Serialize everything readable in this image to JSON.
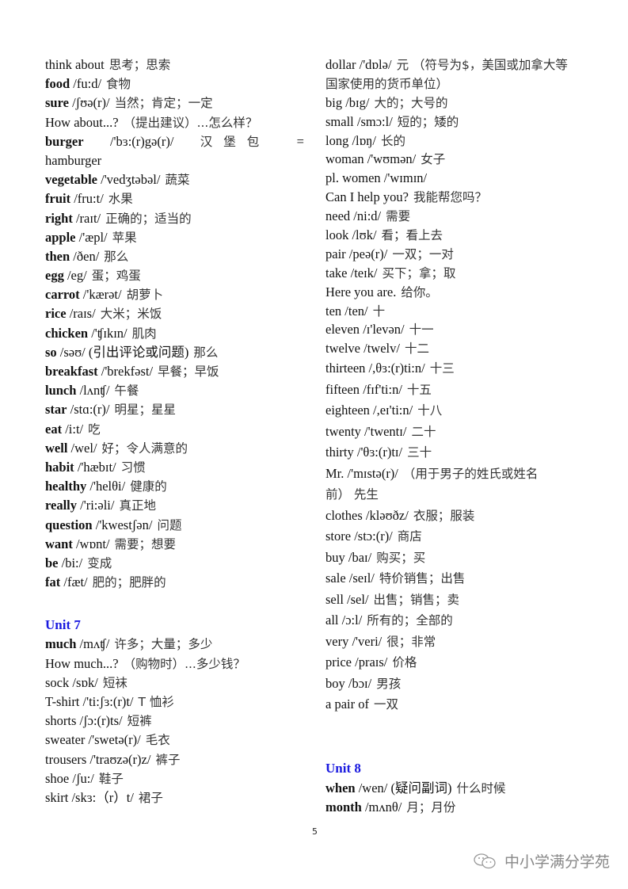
{
  "left_column": [
    {
      "word": "think about",
      "bold": false,
      "phon": "",
      "cn": "思考；思索"
    },
    {
      "word": "food",
      "bold": true,
      "phon": "/fu:d/",
      "cn": "食物"
    },
    {
      "word": "sure",
      "bold": true,
      "phon": "/ʃʊə(r)/",
      "cn": "当然；肯定；一定"
    },
    {
      "word": "How about...?",
      "bold": false,
      "phon": "",
      "cn": "（提出建议）...怎么样？"
    },
    {
      "word": "burger",
      "bold": true,
      "phon": "/'bɜ:(r)gə(r)/",
      "cn": "汉堡包",
      "tail": "=",
      "wrap": "hamburger"
    },
    {
      "word": "vegetable",
      "bold": true,
      "phon": "/'vedʒtəbəl/",
      "cn": "蔬菜"
    },
    {
      "word": "fruit",
      "bold": true,
      "phon": "/fru:t/",
      "cn": "水果"
    },
    {
      "word": "right",
      "bold": true,
      "phon": "/raɪt/",
      "cn": "正确的；适当的"
    },
    {
      "word": "apple",
      "bold": true,
      "phon": "/'æpl/",
      "cn": "苹果"
    },
    {
      "word": "then",
      "bold": true,
      "phon": "/ðen/",
      "cn": "那么"
    },
    {
      "word": "egg",
      "bold": true,
      "phon": "/eg/",
      "cn": "蛋；鸡蛋"
    },
    {
      "word": "carrot",
      "bold": true,
      "phon": "/'kærət/",
      "cn": "胡萝卜"
    },
    {
      "word": "rice",
      "bold": true,
      "phon": "/raɪs/",
      "cn": "大米；米饭"
    },
    {
      "word": "chicken",
      "bold": true,
      "phon": "/'ʧɪkɪn/",
      "cn": "肌肉"
    },
    {
      "word": "so",
      "bold": true,
      "phon": "/səʊ/ (引出评论或问题)",
      "cn": "那么"
    },
    {
      "word": "breakfast",
      "bold": true,
      "phon": "/'brekfəst/",
      "cn": "早餐；早饭"
    },
    {
      "word": "lunch",
      "bold": true,
      "phon": "/lʌnʧ/",
      "cn": "午餐"
    },
    {
      "word": "star",
      "bold": true,
      "phon": "/stɑ:(r)/",
      "cn": "明星；星星"
    },
    {
      "word": "eat",
      "bold": true,
      "phon": "/i:t/",
      "cn": "吃"
    },
    {
      "word": "well",
      "bold": true,
      "phon": "/wel/",
      "cn": "好；令人满意的"
    },
    {
      "word": "habit",
      "bold": true,
      "phon": "/'hæbɪt/",
      "cn": "习惯"
    },
    {
      "word": "healthy",
      "bold": true,
      "phon": "/'helθi/",
      "cn": "健康的"
    },
    {
      "word": "really",
      "bold": true,
      "phon": "/'ri:əli/",
      "cn": "真正地"
    },
    {
      "word": "question",
      "bold": true,
      "phon": "/'kwestʃən/",
      "cn": "问题"
    },
    {
      "word": "want",
      "bold": true,
      "phon": "/wɒnt/",
      "cn": "需要；想要"
    },
    {
      "word": "be",
      "bold": true,
      "phon": "/bi:/",
      "cn": "变成"
    },
    {
      "word": "fat",
      "bold": true,
      "phon": "/fæt/",
      "cn": "肥的；肥胖的"
    }
  ],
  "unit7": {
    "heading": "Unit 7",
    "items": [
      {
        "word": "much",
        "bold": true,
        "phon": "/mʌʧ/",
        "cn": "许多；大量；多少"
      },
      {
        "word": "How much...?",
        "bold": false,
        "phon": "",
        "cn": "（购物时）...多少钱？"
      },
      {
        "word": "sock",
        "bold": false,
        "phon": "/sɒk/",
        "cn": "短袜"
      },
      {
        "word": "T-shirt",
        "bold": false,
        "phon": "/'ti:ʃɜ:(r)t/",
        "cn": "T 恤衫"
      },
      {
        "word": "shorts",
        "bold": false,
        "phon": "/ʃɔ:(r)ts/",
        "cn": "短裤"
      },
      {
        "word": "sweater",
        "bold": false,
        "phon": "/'swetə(r)/",
        "cn": "毛衣"
      },
      {
        "word": "trousers",
        "bold": false,
        "phon": "/'traʊzə(r)z/",
        "cn": "裤子"
      },
      {
        "word": "shoe",
        "bold": false,
        "phon": "/ʃu:/",
        "cn": "鞋子"
      },
      {
        "word": "skirt",
        "bold": false,
        "phon": "/skɜ:（r）t/",
        "cn": "裙子"
      }
    ]
  },
  "right_column": [
    {
      "word": "dollar",
      "bold": false,
      "phon": "/'dɒlə/",
      "cn": "元 （符号为$，美国或加拿大等",
      "wrap": "国家使用的货币单位）"
    },
    {
      "word": "big",
      "bold": false,
      "phon": "/bɪg/",
      "cn": "大的；大号的"
    },
    {
      "word": "small",
      "bold": false,
      "phon": "/smɔ:l/",
      "cn": "短的；矮的"
    },
    {
      "word": "long",
      "bold": false,
      "phon": "/lɒŋ/",
      "cn": "长的"
    },
    {
      "word": "woman",
      "bold": false,
      "phon": "/'wʊmən/",
      "cn": "女子"
    },
    {
      "word": "pl. women",
      "bold": false,
      "phon": "/'wɪmɪn/",
      "cn": ""
    },
    {
      "word": "Can I help you?",
      "bold": false,
      "phon": "",
      "cn": "我能帮您吗？"
    },
    {
      "word": "need",
      "bold": false,
      "phon": "/ni:d/",
      "cn": "需要"
    },
    {
      "word": "look",
      "bold": false,
      "phon": "/lʊk/",
      "cn": "看；看上去"
    },
    {
      "word": "pair",
      "bold": false,
      "phon": "/peə(r)/",
      "cn": "一双；一对"
    },
    {
      "word": "take",
      "bold": false,
      "phon": "/teɪk/",
      "cn": "买下；拿；取"
    },
    {
      "word": "Here you are.",
      "bold": false,
      "phon": "",
      "cn": "给你。"
    },
    {
      "word": "ten",
      "bold": false,
      "phon": "/ten/",
      "cn": "十"
    },
    {
      "word": "eleven",
      "bold": false,
      "phon": "/ɪ'levən/",
      "cn": "十一"
    },
    {
      "word": "twelve",
      "bold": false,
      "phon": "/twelv/",
      "cn": "十二"
    },
    {
      "word": "thirteen",
      "bold": false,
      "phon": "/,θɜ:(r)ti:n/",
      "cn": "十三"
    },
    {
      "word": "fifteen",
      "bold": false,
      "phon": "/fɪf'ti:n/",
      "cn": "十五"
    },
    {
      "word": "eighteen",
      "bold": false,
      "phon": "/,eɪ'ti:n/",
      "cn": "十八"
    },
    {
      "word": "twenty",
      "bold": false,
      "phon": "/'twentɪ/",
      "cn": "二十"
    },
    {
      "word": "thirty",
      "bold": false,
      "phon": "/'θɜ:(r)tɪ/",
      "cn": "三十"
    },
    {
      "word": "Mr.",
      "bold": false,
      "phon": "/'mɪstə(r)/",
      "cn": "（用于男子的姓氏或姓名",
      "wrap": "前） 先生"
    },
    {
      "word": "clothes",
      "bold": false,
      "phon": "/kləʊðz/",
      "cn": "衣服；服装"
    },
    {
      "word": "store",
      "bold": false,
      "phon": "/stɔ:(r)/",
      "cn": "商店"
    },
    {
      "word": "buy",
      "bold": false,
      "phon": "/baɪ/",
      "cn": "购买；买"
    },
    {
      "word": "sale",
      "bold": false,
      "phon": "/seɪl/",
      "cn": "特价销售；出售"
    },
    {
      "word": "sell",
      "bold": false,
      "phon": "/sel/",
      "cn": "出售；销售；卖"
    },
    {
      "word": "all",
      "bold": false,
      "phon": "/ɔ:l/",
      "cn": "所有的；全部的"
    },
    {
      "word": "very",
      "bold": false,
      "phon": "/'veri/",
      "cn": "很；非常"
    },
    {
      "word": "price",
      "bold": false,
      "phon": "/praɪs/",
      "cn": "价格"
    },
    {
      "word": "boy",
      "bold": false,
      "phon": "/bɔɪ/",
      "cn": "男孩"
    },
    {
      "word": "a pair of",
      "bold": false,
      "phon": "",
      "cn": "一双"
    }
  ],
  "unit8": {
    "heading": "Unit 8",
    "items": [
      {
        "word": "when",
        "bold": true,
        "phon": "/wen/ (疑问副词)",
        "cn": "什么时候"
      },
      {
        "word": "month",
        "bold": true,
        "phon": "/mʌnθ/",
        "cn": "月；月份"
      }
    ]
  },
  "footer": {
    "page_number": "5",
    "watermark": "中小学满分学苑",
    "watermark_icon": "wechat-icon"
  },
  "colors": {
    "unit_heading": "#1a1adf",
    "text": "#111111",
    "watermark": "#888888"
  }
}
